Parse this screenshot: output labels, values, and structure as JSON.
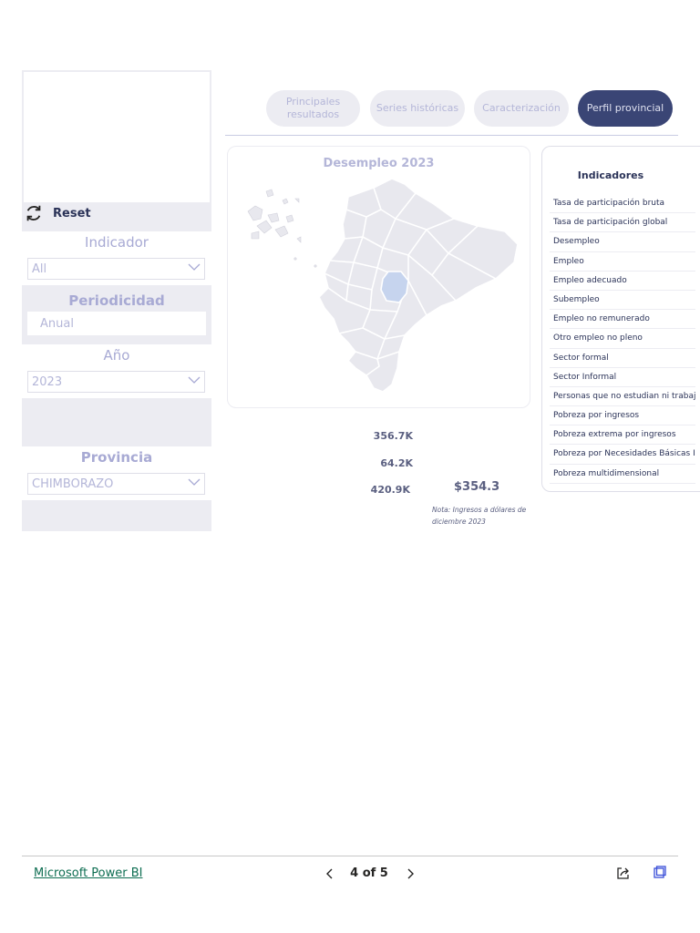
{
  "sidebar": {
    "reset_label": "Reset",
    "indicador": {
      "title": "Indicador",
      "value": "All"
    },
    "periodicidad": {
      "title": "Periodicidad",
      "value": "Anual"
    },
    "anio": {
      "title": "Año",
      "value": "2023"
    },
    "provincia": {
      "title": "Provincia",
      "value": "CHIMBORAZO"
    }
  },
  "tabs": [
    {
      "label": "Principales resultados",
      "active": false
    },
    {
      "label": "Series históricas",
      "active": false
    },
    {
      "label": "Caracterización",
      "active": false
    },
    {
      "label": "Perfil provincial",
      "active": true
    }
  ],
  "map": {
    "title": "Desempleo 2023",
    "base_color": "#e8e8ee",
    "highlight_color": "#c6d4ee"
  },
  "indicators": {
    "title": "Indicadores",
    "items": [
      "Tasa de participación bruta",
      "Tasa de participación global",
      "Desempleo",
      "Empleo",
      "Empleo adecuado",
      "Subempleo",
      "Empleo no remunerado",
      "Otro empleo no pleno",
      "Sector formal",
      "Sector Informal",
      "Personas que no estudian ni trabajan",
      "Pobreza por ingresos",
      "Pobreza extrema por ingresos",
      "Pobreza por Necesidades Básicas Insatisfechas",
      "Pobreza multidimensional"
    ]
  },
  "stats": {
    "s1": "356.7K",
    "s2": "64.2K",
    "s3": "420.9K",
    "income": "$354.3",
    "note": "Nota: Ingresos a dólares de diciembre 2023"
  },
  "footer": {
    "brand": "Microsoft Power BI",
    "page_indicator": "4 of 5"
  },
  "colors": {
    "accent": "#3a4575",
    "muted": "#b4b6d8",
    "band": "#ececf2",
    "brand": "#0e6e52"
  }
}
